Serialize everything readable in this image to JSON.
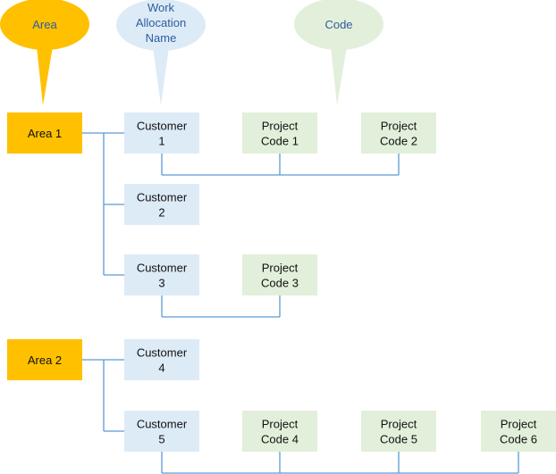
{
  "colors": {
    "area": "#FFC000",
    "customer": "#DDEBF7",
    "code": "#E2EFDA",
    "connector": "#5B9BD5",
    "callout_text": "#2E5C9E"
  },
  "callouts": [
    {
      "key": "area",
      "lines": [
        "Area"
      ],
      "color": "#FFC000"
    },
    {
      "key": "customer",
      "lines": [
        "Work",
        "Allocation",
        "Name"
      ],
      "color": "#DDEBF7"
    },
    {
      "key": "code",
      "lines": [
        "Code"
      ],
      "color": "#E2EFDA"
    }
  ],
  "areas": [
    {
      "label": "Area 1",
      "customers": [
        {
          "lines": [
            "Customer",
            "1"
          ],
          "codes": [
            [
              "Project",
              "Code 1"
            ],
            [
              "Project",
              "Code 2"
            ]
          ]
        },
        {
          "lines": [
            "Customer",
            "2"
          ],
          "codes": []
        },
        {
          "lines": [
            "Customer",
            "3"
          ],
          "codes": [
            [
              "Project",
              "Code 3"
            ]
          ]
        }
      ]
    },
    {
      "label": "Area 2",
      "customers": [
        {
          "lines": [
            "Customer",
            "4"
          ],
          "codes": []
        },
        {
          "lines": [
            "Customer",
            "5"
          ],
          "codes": [
            [
              "Project",
              "Code 4"
            ],
            [
              "Project",
              "Code 5"
            ],
            [
              "Project",
              "Code 6"
            ]
          ]
        }
      ]
    }
  ]
}
